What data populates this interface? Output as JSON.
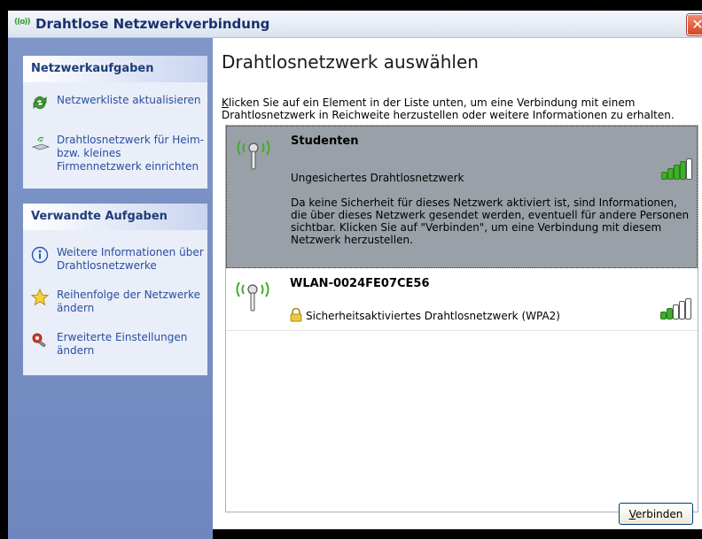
{
  "window": {
    "title": "Drahtlose Netzwerkverbindung",
    "title_icon": "((o))",
    "close_glyph": "✕"
  },
  "sidebar": {
    "network_tasks": {
      "header": "Netzwerkaufgaben",
      "items": [
        {
          "label": "Netzwerkliste aktualisieren",
          "icon": "refresh-icon"
        },
        {
          "label": "Drahtlosnetzwerk für Heim- bzw. kleines Firmennetzwerk einrichten",
          "icon": "wireless-setup-icon"
        }
      ]
    },
    "related_tasks": {
      "header": "Verwandte Aufgaben",
      "items": [
        {
          "label": "Weitere Informationen über Drahtlosnetzwerke",
          "icon": "info-icon"
        },
        {
          "label": "Reihenfolge der Netzwerke ändern",
          "icon": "star-icon"
        },
        {
          "label": "Erweiterte Einstellungen ändern",
          "icon": "settings-icon"
        }
      ]
    }
  },
  "main": {
    "title": "Drahtlosnetzwerk auswählen",
    "instruction_first_letter": "K",
    "instruction_rest": "licken Sie auf ein Element in der Liste unten, um eine Verbindung mit einem Drahtlosnetzwerk in Reichweite herzustellen oder weitere Informationen zu erhalten.",
    "networks": [
      {
        "name": "Studenten",
        "security": "Ungesichertes Drahtlosnetzwerk",
        "description": "Da keine Sicherheit für dieses Netzwerk aktiviert ist, sind Informationen, die über dieses Netzwerk gesendet werden, eventuell für andere Personen sichtbar. Klicken Sie auf \"Verbinden\", um eine Verbindung mit diesem Netzwerk herzustellen.",
        "selected": true,
        "signal_bars": 4,
        "secured": false
      },
      {
        "name": "WLAN-0024FE07CE56",
        "security": "Sicherheitsaktiviertes Drahtlosnetzwerk (WPA2)",
        "selected": false,
        "signal_bars": 2,
        "secured": true
      }
    ],
    "connect_button_first": "V",
    "connect_button_rest": "erbinden"
  },
  "colors": {
    "sidebar_bg": "#7489c0",
    "selected_row": "#9aa0a7",
    "signal_on": "#3fae2a",
    "signal_off": "#ffffff"
  }
}
